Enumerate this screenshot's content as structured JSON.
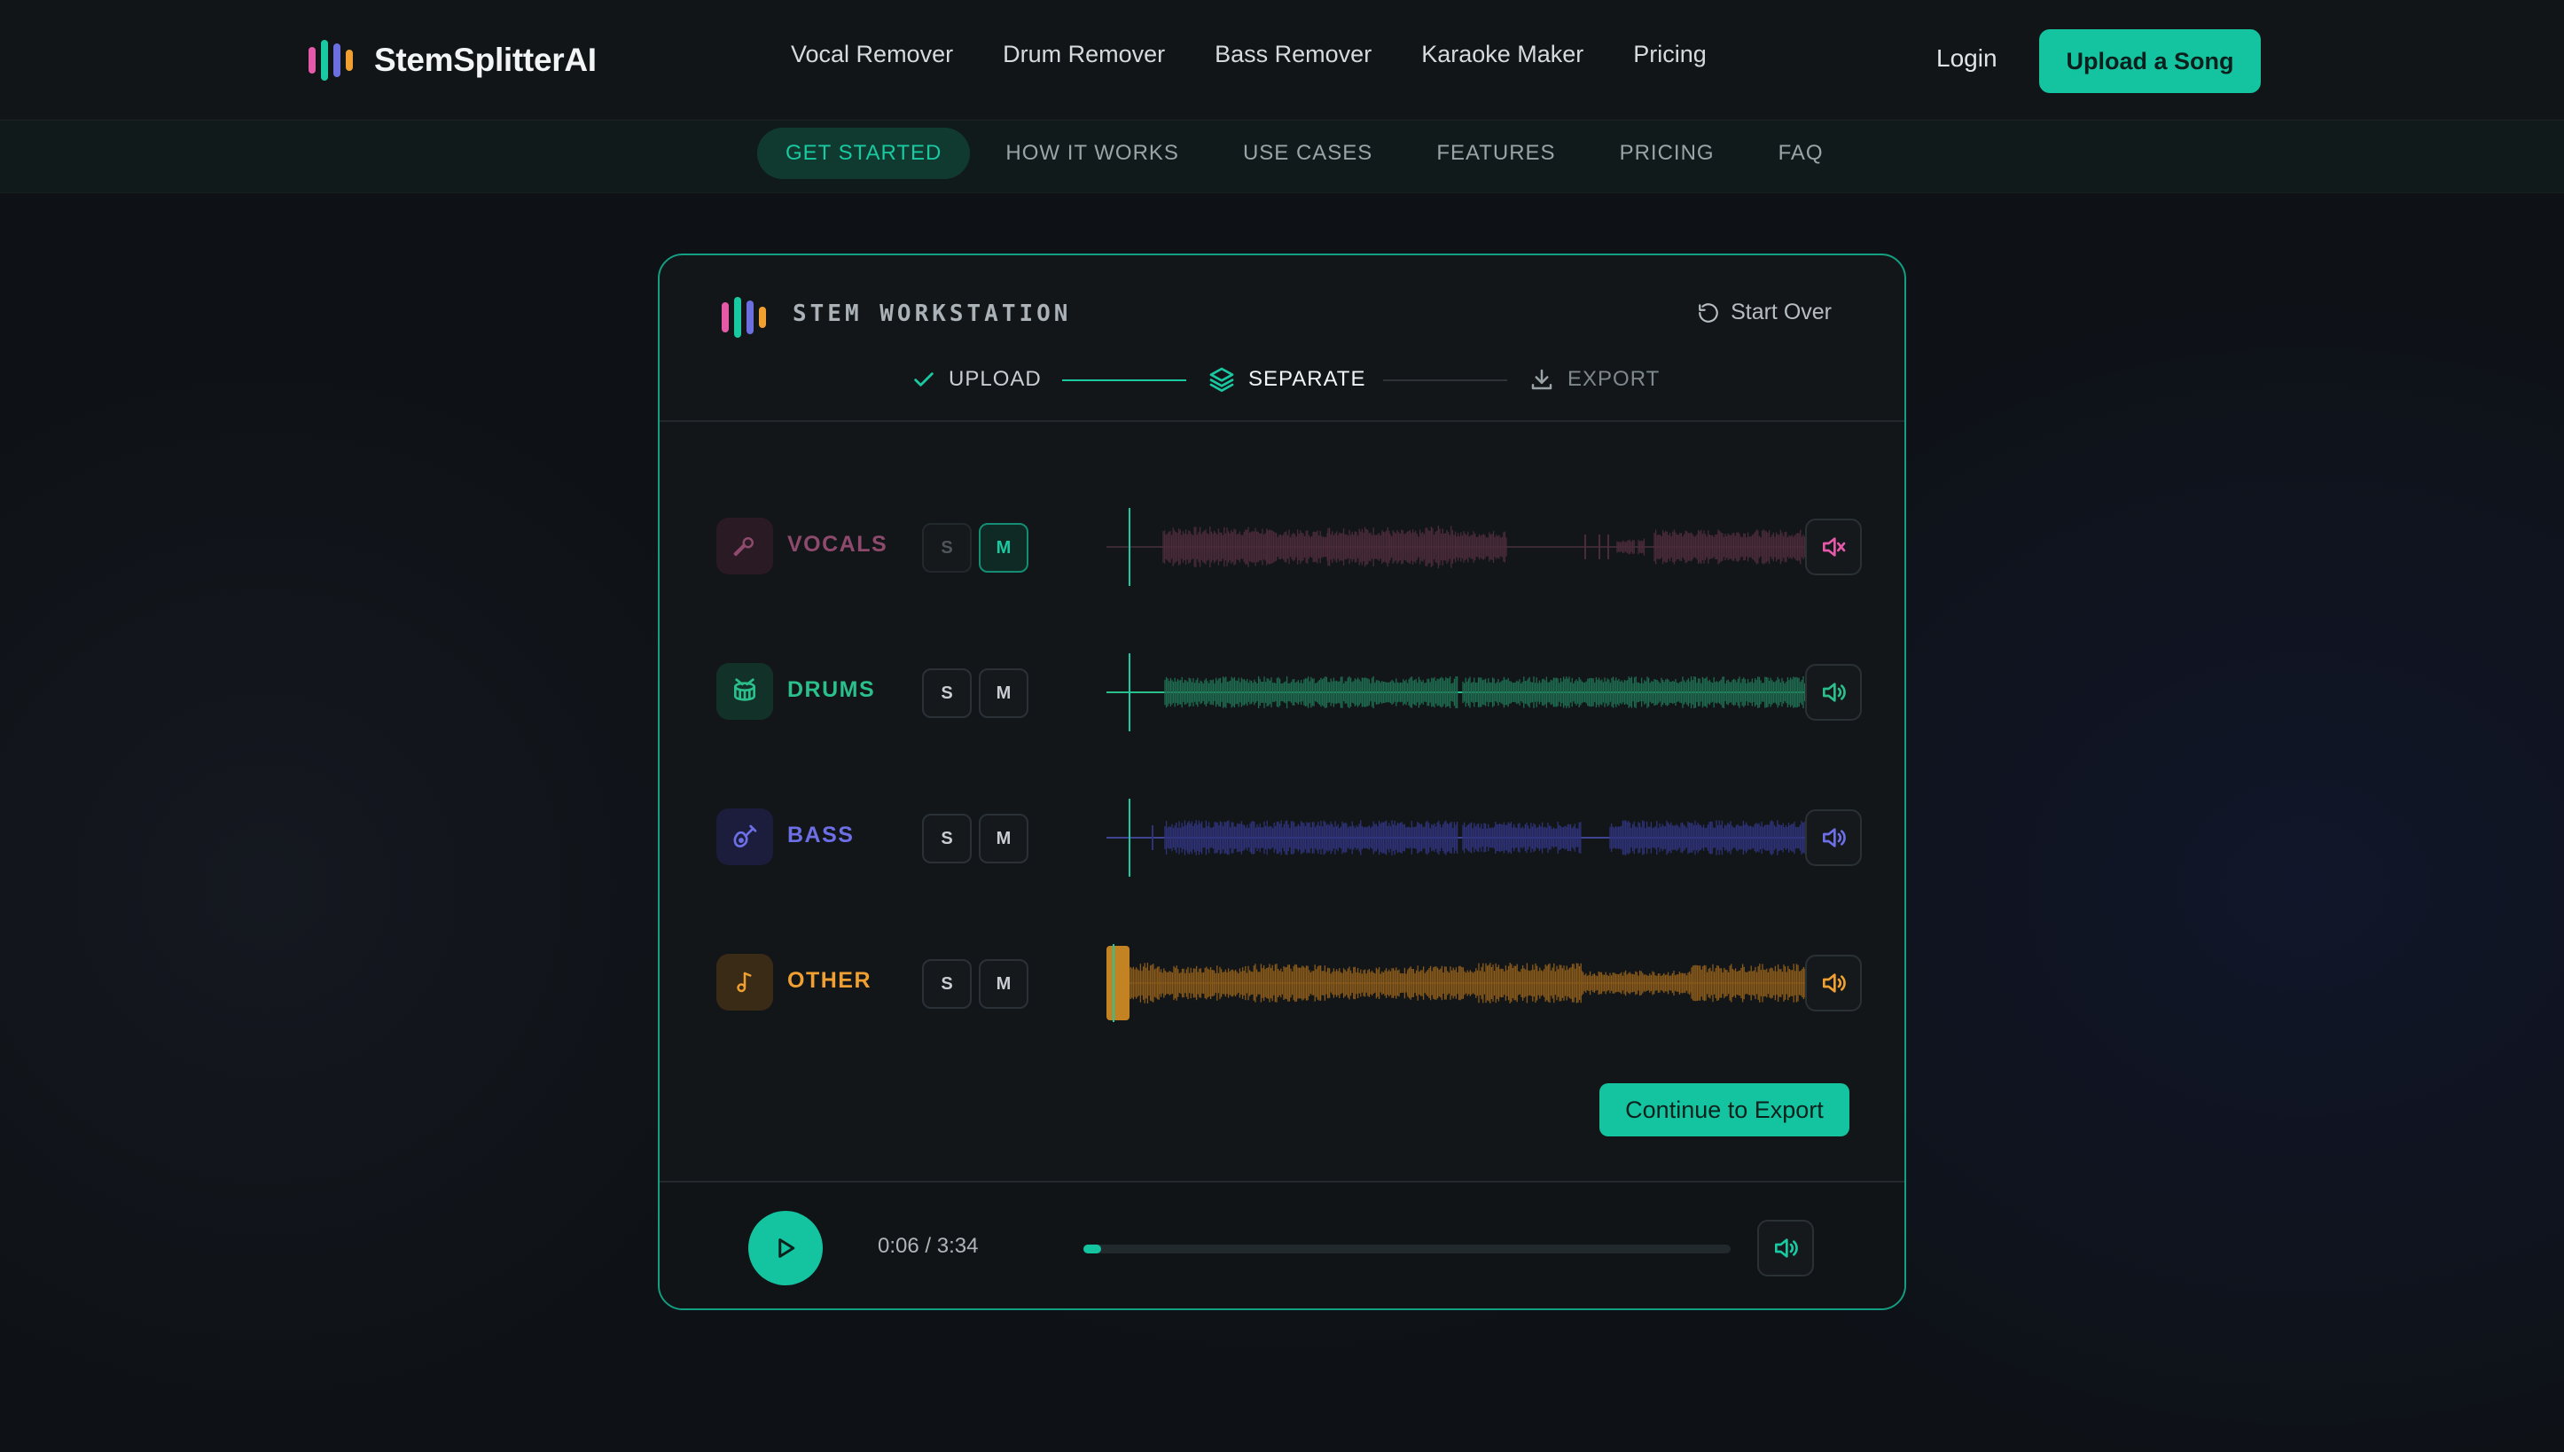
{
  "brand": {
    "name": "StemSplitterAI",
    "logo_colors": [
      "#e45aa8",
      "#19c9a1",
      "#6b6fe0",
      "#f0a030"
    ]
  },
  "nav": {
    "links": [
      "Vocal Remover",
      "Drum Remover",
      "Bass Remover",
      "Karaoke Maker",
      "Pricing"
    ],
    "login_label": "Login",
    "upload_label": "Upload a Song"
  },
  "subnav": {
    "items": [
      "GET STARTED",
      "HOW IT WORKS",
      "USE CASES",
      "FEATURES",
      "PRICING",
      "FAQ"
    ],
    "active_index": 0
  },
  "workstation": {
    "title": "STEM WORKSTATION",
    "start_over_label": "Start Over",
    "steps": [
      {
        "label": "UPLOAD",
        "state": "done",
        "icon": "check-icon"
      },
      {
        "label": "SEPARATE",
        "state": "active",
        "icon": "layers-icon"
      },
      {
        "label": "EXPORT",
        "state": "pending",
        "icon": "download-icon"
      }
    ],
    "tracks": [
      {
        "key": "vocals",
        "label": "VOCALS",
        "icon": "microphone-icon",
        "color": "#b65c8a",
        "solo_label": "S",
        "mute_label": "M",
        "muted": true
      },
      {
        "key": "drums",
        "label": "DRUMS",
        "icon": "drum-icon",
        "color": "#2bbf8c",
        "solo_label": "S",
        "mute_label": "M",
        "muted": false
      },
      {
        "key": "bass",
        "label": "BASS",
        "icon": "guitar-icon",
        "color": "#6d6fe6",
        "solo_label": "S",
        "mute_label": "M",
        "muted": false
      },
      {
        "key": "other",
        "label": "OTHER",
        "icon": "music-note-icon",
        "color": "#f0a030",
        "solo_label": "S",
        "mute_label": "M",
        "muted": false
      }
    ],
    "continue_label": "Continue to Export"
  },
  "transport": {
    "time": "0:06 / 3:34",
    "progress_fraction": 0.028
  }
}
